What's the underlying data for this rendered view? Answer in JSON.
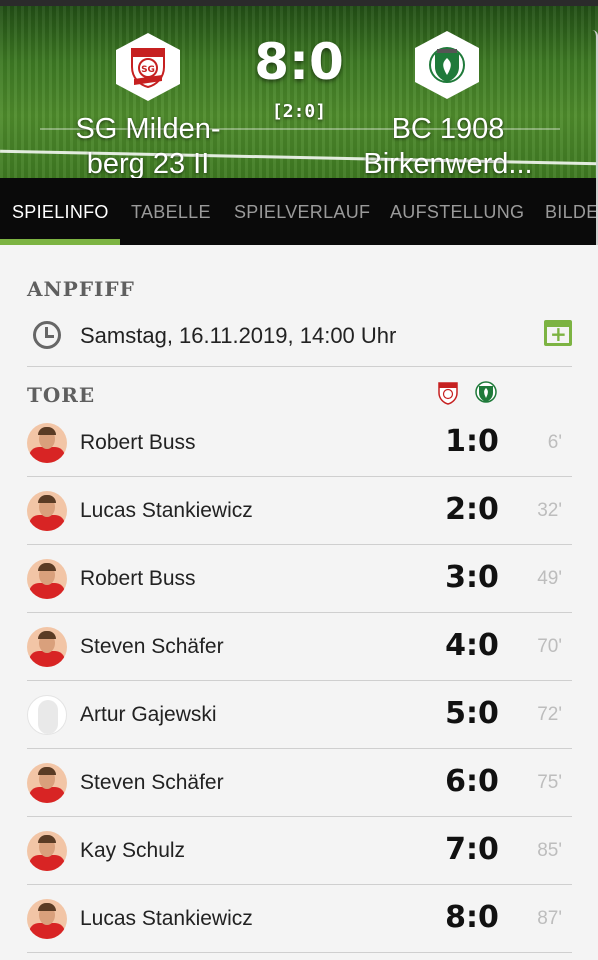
{
  "match": {
    "home_team": "SG Milden-berg 23 II",
    "home_team_line1": "SG Milden-",
    "home_team_line2": "berg 23 II",
    "away_team_line1": "BC 1908",
    "away_team_line2": "Birkenwerd...",
    "score": "8:0",
    "halftime_score": "[2:0]",
    "home_crest_icon": "sg-mildenberg-crest",
    "away_crest_icon": "bc-1908-birkenwerder-crest"
  },
  "tabs": [
    {
      "label": "SPIELINFO",
      "active": true
    },
    {
      "label": "TABELLE",
      "active": false
    },
    {
      "label": "SPIELVERLAUF",
      "active": false
    },
    {
      "label": "AUFSTELLUNG",
      "active": false
    },
    {
      "label": "BILDE",
      "active": false
    }
  ],
  "kickoff": {
    "title": "ANPFIFF",
    "datetime": "Samstag, 16.11.2019, 14:00 Uhr",
    "icon": "clock-icon",
    "action_icon": "calendar-add-icon"
  },
  "goals": {
    "title": "TORE",
    "items": [
      {
        "player": "Robert Buss",
        "score": "1:0",
        "minute": "6'"
      },
      {
        "player": "Lucas Stankiewicz",
        "score": "2:0",
        "minute": "32'"
      },
      {
        "player": "Robert Buss",
        "score": "3:0",
        "minute": "49'"
      },
      {
        "player": "Steven Schäfer",
        "score": "4:0",
        "minute": "70'"
      },
      {
        "player": "Artur Gajewski",
        "score": "5:0",
        "minute": "72'"
      },
      {
        "player": "Steven Schäfer",
        "score": "6:0",
        "minute": "75'"
      },
      {
        "player": "Kay Schulz",
        "score": "7:0",
        "minute": "85'"
      },
      {
        "player": "Lucas Stankiewicz",
        "score": "8:0",
        "minute": "87'"
      }
    ]
  },
  "colors": {
    "accent": "#7cb342",
    "tabbar_bg": "#0a0a0a",
    "home_red": "#d82424",
    "away_green": "#1f7a3a"
  }
}
